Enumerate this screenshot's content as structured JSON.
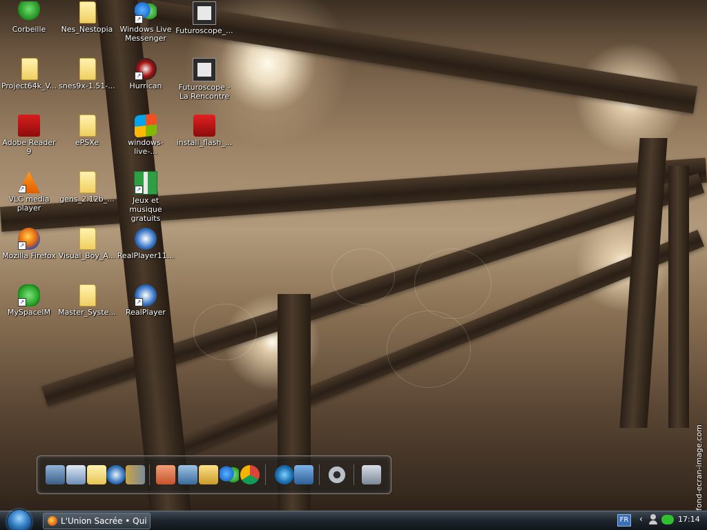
{
  "desktop": {
    "icons": [
      {
        "label": "Corbeille",
        "icon": "recycle-bin-tree-icon",
        "shortcut": false
      },
      {
        "label": "Nes_Nestopia",
        "icon": "folder-icon",
        "shortcut": false
      },
      {
        "label": "Windows Live Messenger",
        "icon": "messenger-icon",
        "shortcut": true
      },
      {
        "label": "Futuroscope_...",
        "icon": "spider-icon",
        "shortcut": false
      },
      {
        "label": "Project64k_V...",
        "icon": "folder-icon",
        "shortcut": false
      },
      {
        "label": "snes9x-1.51-...",
        "icon": "folder-icon",
        "shortcut": false
      },
      {
        "label": "Hurrican",
        "icon": "hurrican-icon",
        "shortcut": true
      },
      {
        "label": "Futuroscope - La Rencontre",
        "icon": "spider-icon",
        "shortcut": false
      },
      {
        "label": "Adobe Reader 9",
        "icon": "adobe-reader-icon",
        "shortcut": false
      },
      {
        "label": "ePSXe",
        "icon": "folder-icon",
        "shortcut": false
      },
      {
        "label": "windows-live-...",
        "icon": "windows-logo-icon",
        "shortcut": false
      },
      {
        "label": "install_flash_...",
        "icon": "flash-icon",
        "shortcut": false
      },
      {
        "label": "VLC media player",
        "icon": "vlc-icon",
        "shortcut": true
      },
      {
        "label": "gens_2.12b_...",
        "icon": "folder-icon",
        "shortcut": false
      },
      {
        "label": "Jeux et musique gratuits",
        "icon": "gift-icon",
        "shortcut": true
      },
      {
        "label": "Mozilla Firefox",
        "icon": "firefox-icon",
        "shortcut": true
      },
      {
        "label": "Visual_Boy_A...",
        "icon": "folder-icon",
        "shortcut": false
      },
      {
        "label": "RealPlayer11...",
        "icon": "realplayer-icon",
        "shortcut": false
      },
      {
        "label": "MySpaceIM",
        "icon": "myspaceim-icon",
        "shortcut": true
      },
      {
        "label": "Master_Syste...",
        "icon": "folder-icon",
        "shortcut": false
      },
      {
        "label": "RealPlayer",
        "icon": "realplayer-icon",
        "shortcut": true
      }
    ]
  },
  "watermark": "fond-ecran-image.com",
  "dock": {
    "items": [
      "computer-icon",
      "checklist-icon",
      "folder-icon",
      "globe-icon",
      "books-icon",
      "documents-icon",
      "notebook-icon",
      "folder-open-icon",
      "messenger-icon",
      "chrome-icon",
      "earth-icon",
      "media-player-icon",
      "settings-gear-icon",
      "recycle-bin-icon"
    ]
  },
  "taskbar": {
    "task_label": "L'Union Sacrée • Qui e...",
    "language": "FR",
    "tray_chevron": "‹",
    "clock": "17:14"
  }
}
